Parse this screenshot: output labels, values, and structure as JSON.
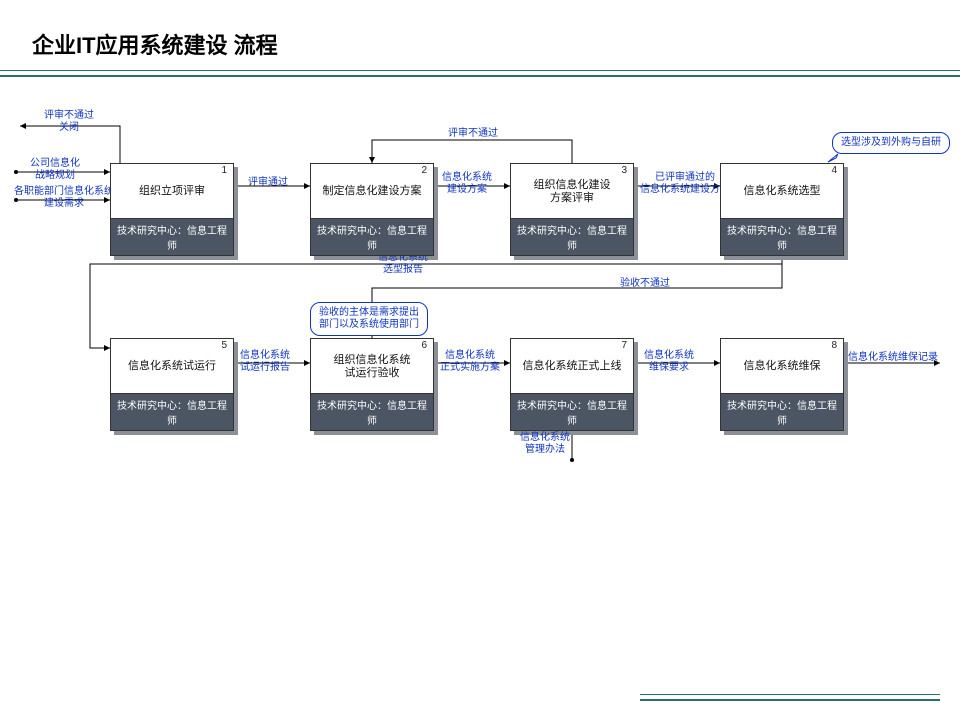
{
  "title": "企业IT应用系统建设 流程",
  "role": "技术研究中心：信息工程师",
  "nodes": {
    "n1": {
      "num": "1",
      "title": "组织立项评审"
    },
    "n2": {
      "num": "2",
      "title": "制定信息化建设方案"
    },
    "n3": {
      "num": "3",
      "title": "组织信息化建设\n方案评审"
    },
    "n4": {
      "num": "4",
      "title": "信息化系统选型"
    },
    "n5": {
      "num": "5",
      "title": "信息化系统试运行"
    },
    "n6": {
      "num": "6",
      "title": "组织信息化系统\n试运行验收"
    },
    "n7": {
      "num": "7",
      "title": "信息化系统正式上线"
    },
    "n8": {
      "num": "8",
      "title": "信息化系统维保"
    }
  },
  "edges": {
    "e_in1": "公司信息化\n战略规划",
    "e_in2": "各职能部门信息化系统\n建设需求",
    "e_reject1": "评审不通过\n关闭",
    "e_1_2": "评审通过",
    "e_2_3": "信息化系统\n建设方案",
    "e_3_2_reject": "评审不通过",
    "e_3_4": "已评审通过的\n信息化系统建设方案",
    "e_4_5": "信息化系统\n选型报告",
    "e_5_6": "信息化系统\n试运行报告",
    "e_6_7": "信息化系统\n正式实施方案",
    "e_6_4_reject": "验收不通过",
    "e_7_8": "信息化系统\n维保要求",
    "e_7_in": "信息化系统\n管理办法",
    "e_out": "信息化系统维保记录"
  },
  "callouts": {
    "c4": "选型涉及到外购与自研",
    "c6": "验收的主体是需求提出\n部门以及系统使用部门"
  }
}
